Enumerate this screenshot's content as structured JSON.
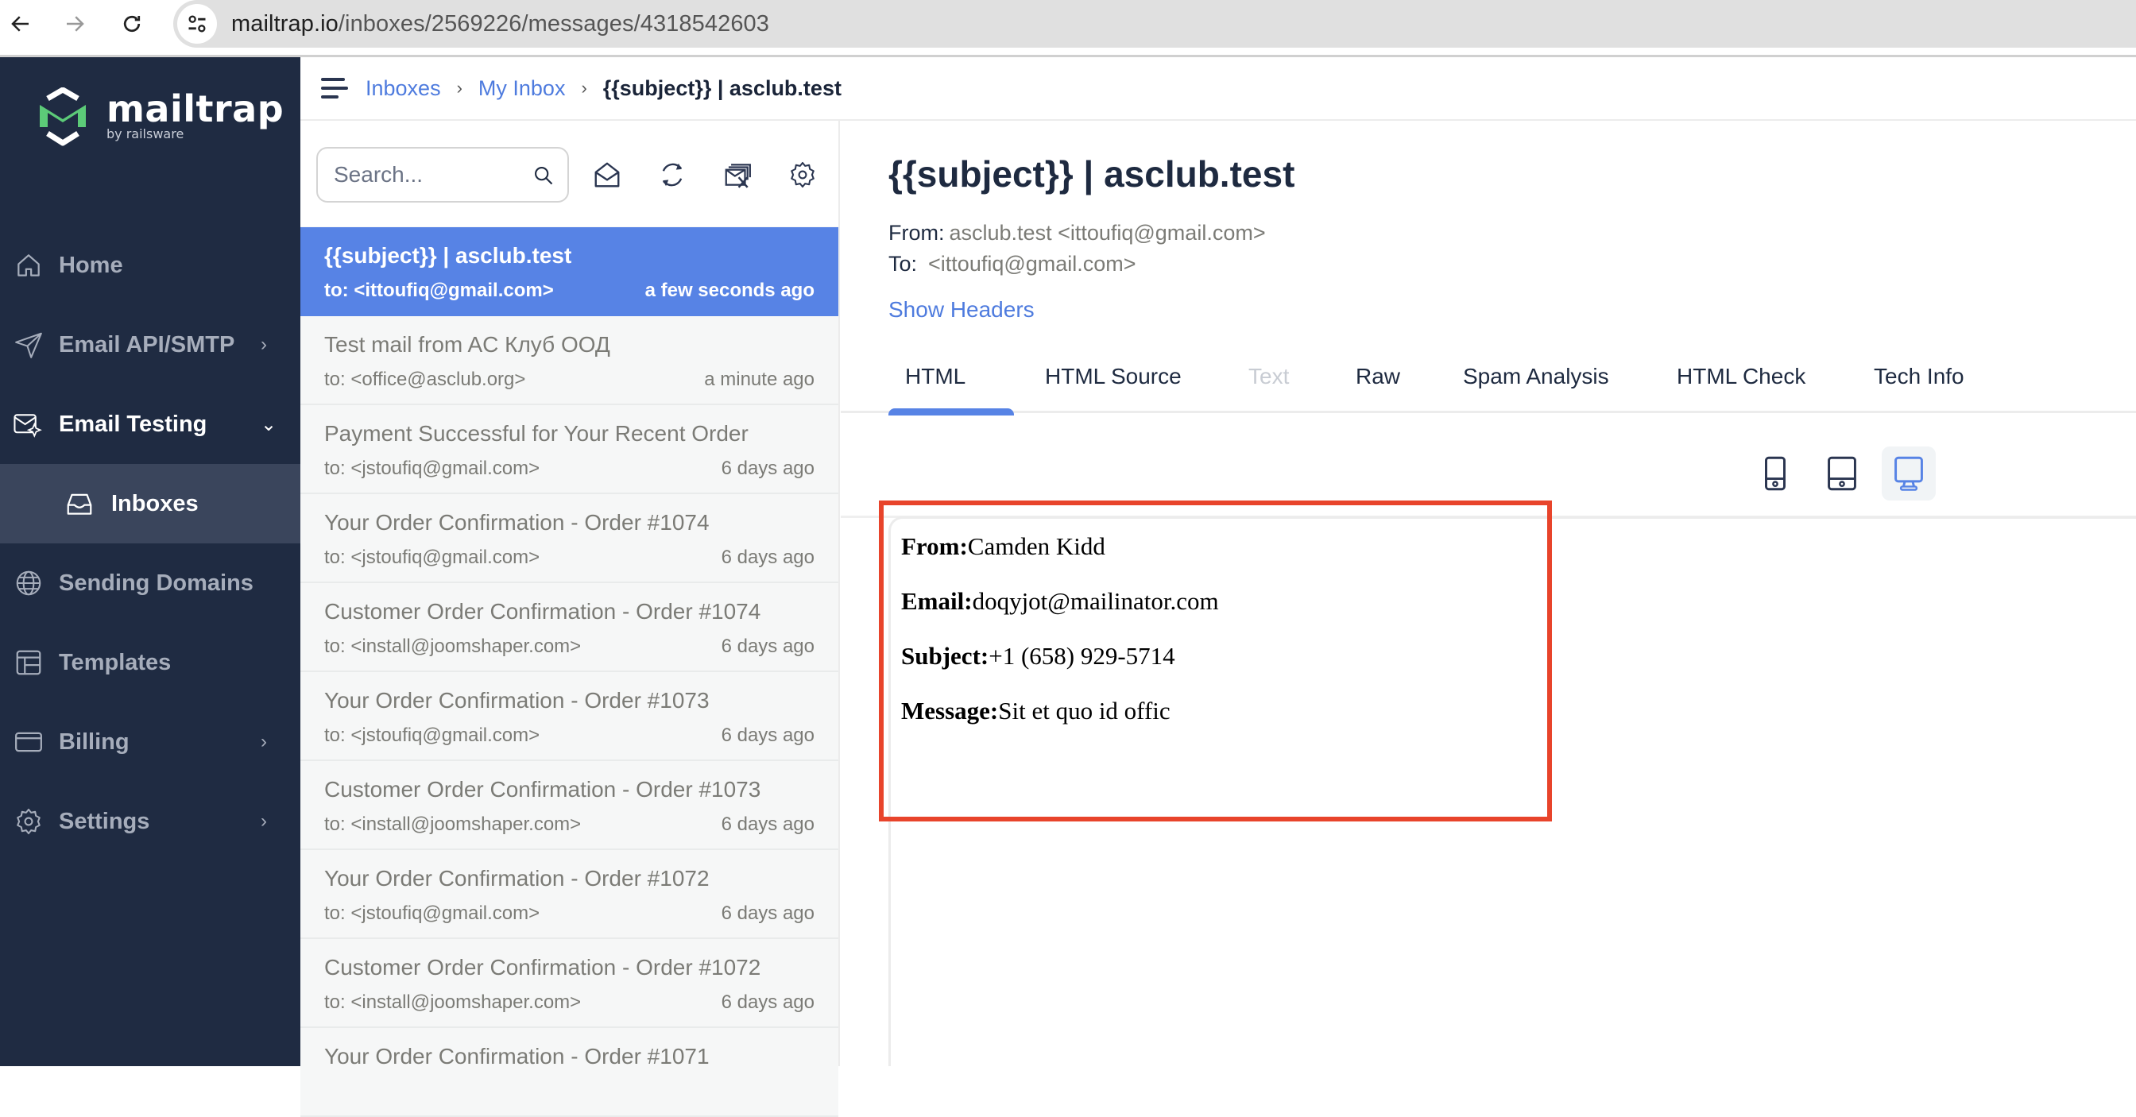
{
  "browser": {
    "url_host": "mailtrap.io",
    "url_path": "/inboxes/2569226/messages/4318542603"
  },
  "sidebar": {
    "logo": {
      "name": "mailtrap",
      "tagline": "by railsware",
      "accent": "#5ccb78"
    },
    "items": [
      {
        "label": "Home",
        "icon": "home-icon",
        "chevron": ""
      },
      {
        "label": "Email API/SMTP",
        "icon": "send-icon",
        "chevron": "›"
      },
      {
        "label": "Email Testing",
        "icon": "email-testing-icon",
        "chevron": "⌄"
      },
      {
        "label": "Inboxes",
        "icon": "inbox-icon",
        "chevron": ""
      },
      {
        "label": "Sending Domains",
        "icon": "globe-icon",
        "chevron": ""
      },
      {
        "label": "Templates",
        "icon": "templates-icon",
        "chevron": ""
      },
      {
        "label": "Billing",
        "icon": "billing-icon",
        "chevron": "›"
      },
      {
        "label": "Settings",
        "icon": "settings-icon",
        "chevron": "›"
      }
    ]
  },
  "breadcrumb": {
    "items": [
      "Inboxes",
      "My Inbox",
      "{{subject}} | asclub.test"
    ],
    "separator": "›"
  },
  "toolbar": {
    "search_placeholder": "Search...",
    "buttons": [
      "mark-read-icon",
      "refresh-icon",
      "clear-inbox-icon",
      "settings-icon"
    ]
  },
  "messages": [
    {
      "subject": "{{subject}} | asclub.test",
      "to": "to: <ittoufiq@gmail.com>",
      "time": "a few seconds ago",
      "selected": true
    },
    {
      "subject": "Test mail from AC Клуб ООД",
      "to": "to: <office@asclub.org>",
      "time": "a minute ago"
    },
    {
      "subject": "Payment Successful for Your Recent Order",
      "to": "to: <jstoufiq@gmail.com>",
      "time": "6 days ago"
    },
    {
      "subject": "Your Order Confirmation - Order #1074",
      "to": "to: <jstoufiq@gmail.com>",
      "time": "6 days ago"
    },
    {
      "subject": "Customer Order Confirmation - Order #1074",
      "to": "to: <install@joomshaper.com>",
      "time": "6 days ago"
    },
    {
      "subject": "Your Order Confirmation - Order #1073",
      "to": "to: <jstoufiq@gmail.com>",
      "time": "6 days ago"
    },
    {
      "subject": "Customer Order Confirmation - Order #1073",
      "to": "to: <install@joomshaper.com>",
      "time": "6 days ago"
    },
    {
      "subject": "Your Order Confirmation - Order #1072",
      "to": "to: <jstoufiq@gmail.com>",
      "time": "6 days ago"
    },
    {
      "subject": "Customer Order Confirmation - Order #1072",
      "to": "to: <install@joomshaper.com>",
      "time": "6 days ago"
    },
    {
      "subject": "Your Order Confirmation - Order #1071",
      "to": "",
      "time": ""
    }
  ],
  "message": {
    "title": "{{subject}} | asclub.test",
    "from_label": "From:",
    "from_value": "asclub.test <ittoufiq@gmail.com>",
    "to_label": "To:",
    "to_value": "<ittoufiq@gmail.com>",
    "show_headers": "Show Headers",
    "tabs": [
      {
        "label": "HTML",
        "active": true
      },
      {
        "label": "HTML Source"
      },
      {
        "label": "Text",
        "disabled": true
      },
      {
        "label": "Raw"
      },
      {
        "label": "Spam Analysis"
      },
      {
        "label": "HTML Check"
      },
      {
        "label": "Tech Info"
      }
    ],
    "devices": [
      "mobile",
      "tablet",
      "desktop"
    ],
    "active_device": "desktop",
    "body": [
      {
        "label": "From:",
        "value": "Camden Kidd"
      },
      {
        "label": "Email:",
        "value": "doqyjot@mailinator.com"
      },
      {
        "label": "Subject:",
        "value": "+1 (658) 929-5714"
      },
      {
        "label": "Message:",
        "value": "Sit et quo id offic"
      }
    ]
  },
  "colors": {
    "sidebar_bg": "#1f2b42",
    "sidebar_selected": "#3a455c",
    "accent_blue": "#5783e5",
    "link_blue": "#4e7bde",
    "highlight_red": "#e8442b"
  }
}
